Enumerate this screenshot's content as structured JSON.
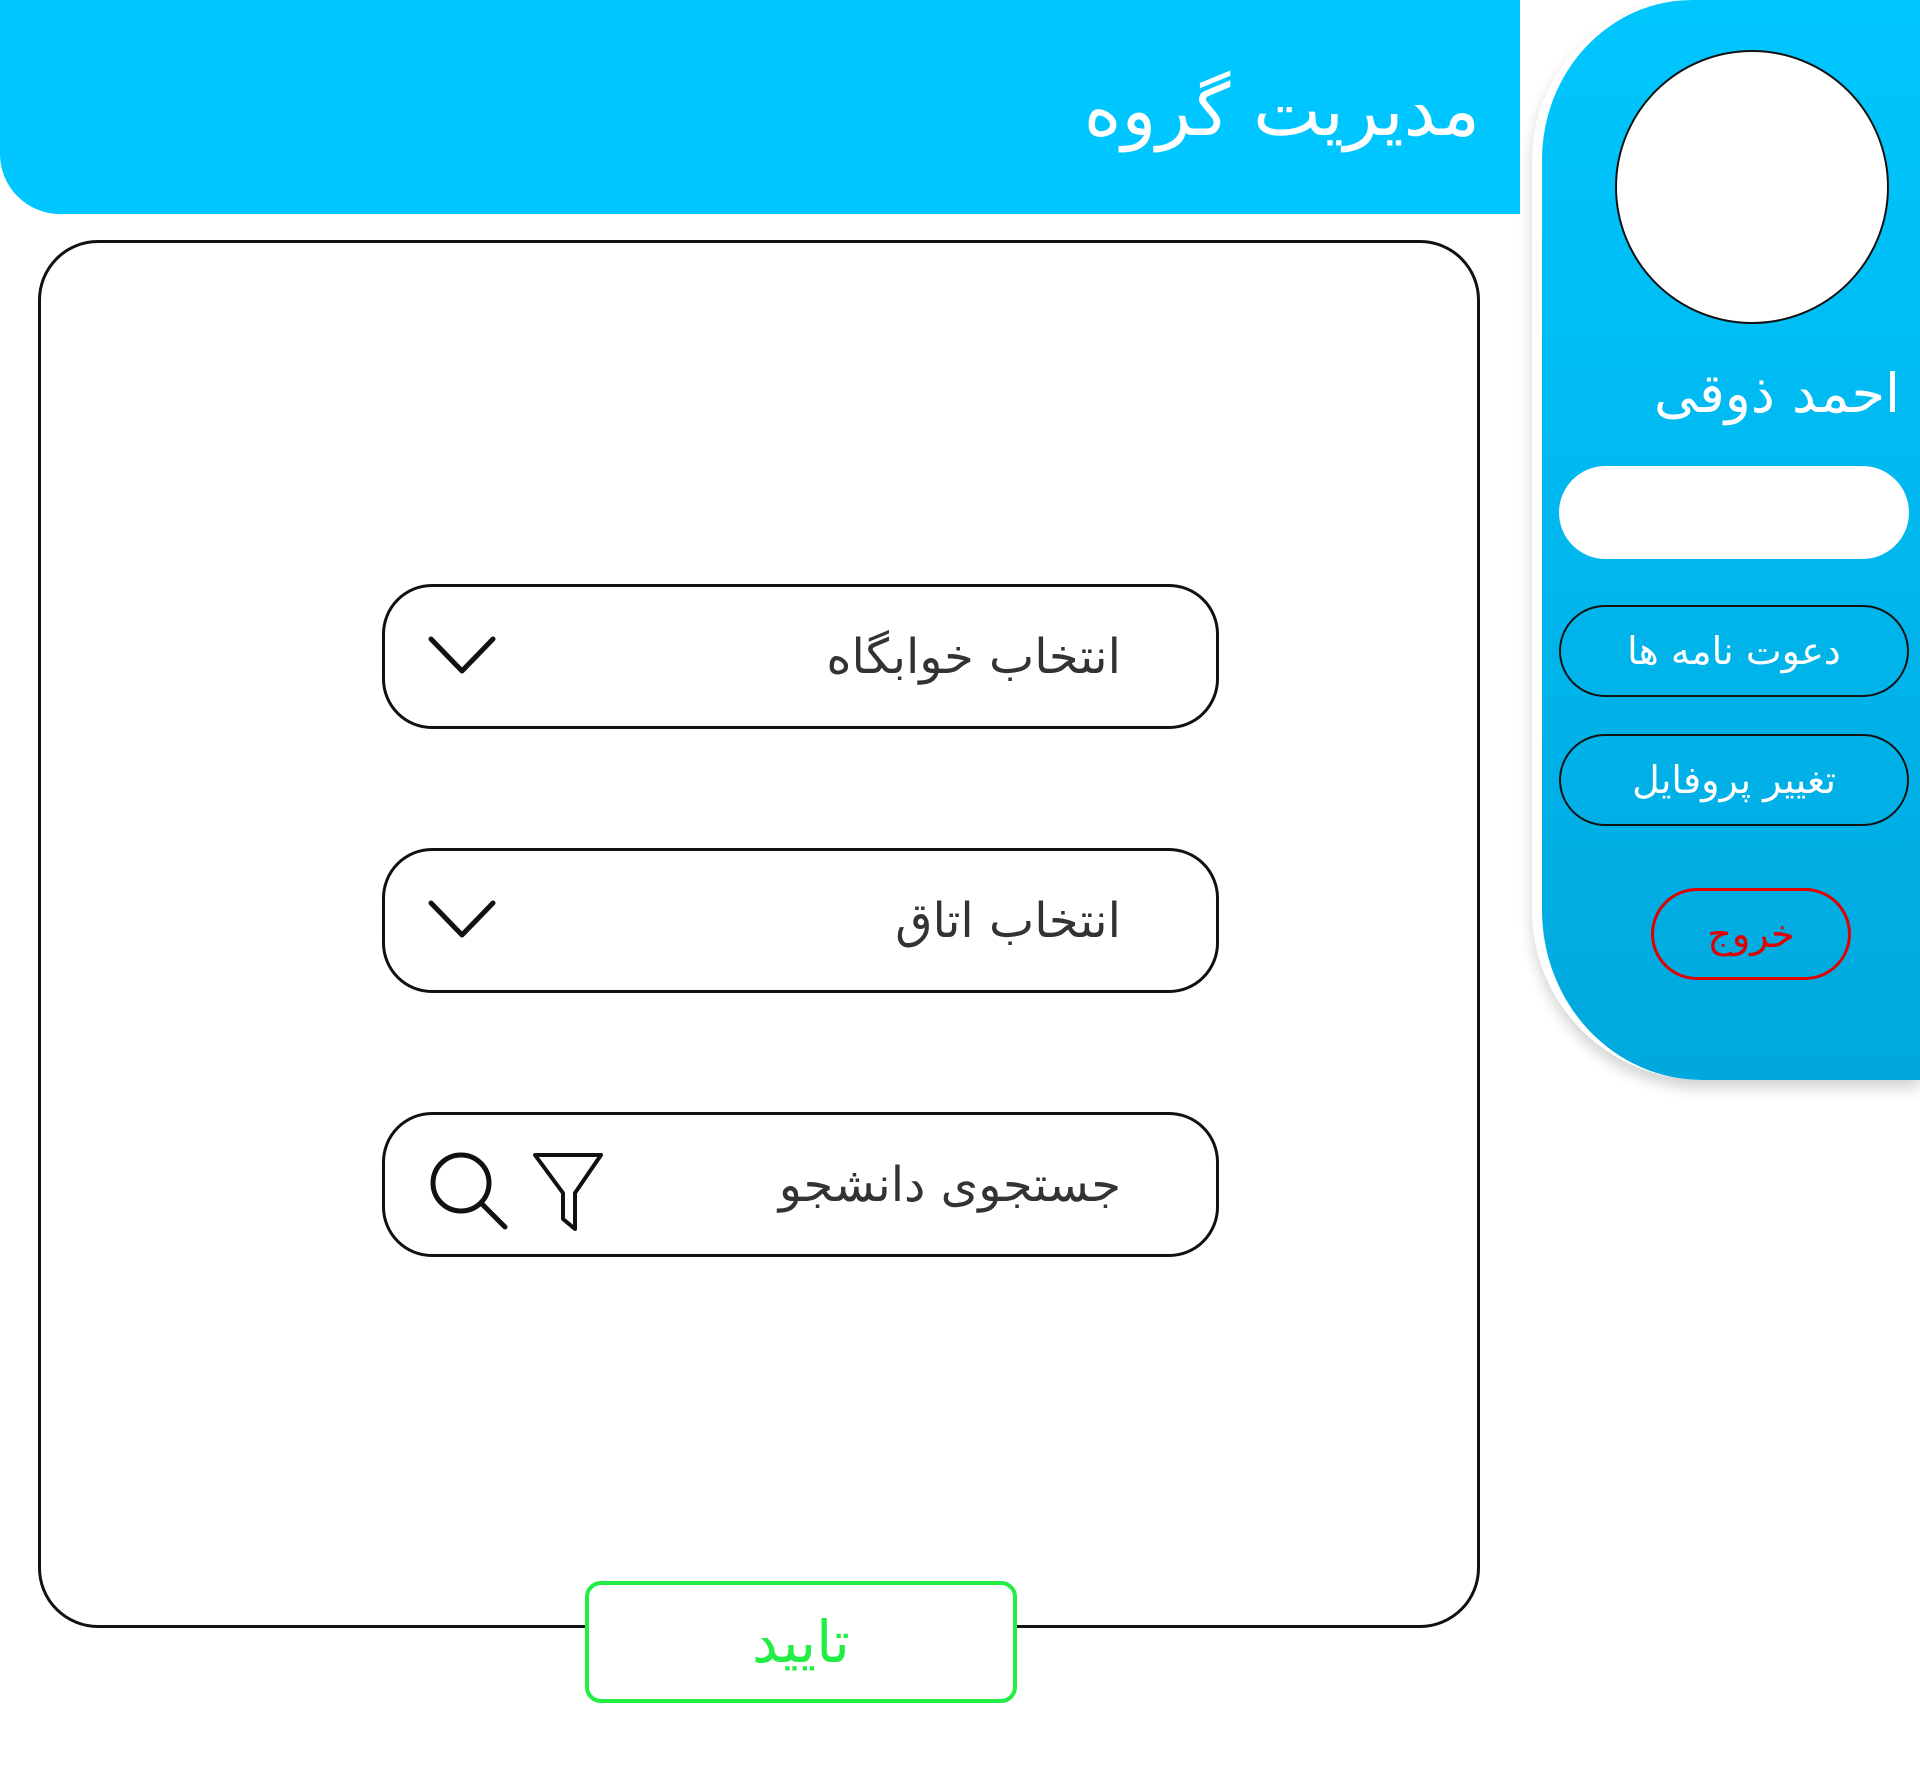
{
  "header": {
    "title": "مدیریت گروه"
  },
  "sidebar": {
    "user_name": "احمد ذوقی",
    "buttons": {
      "invites": "دعوت نامه ها",
      "change_profile": "تغییر پروفایل",
      "logout": "خروج"
    }
  },
  "main": {
    "dorm_select_label": "انتخاب خوابگاه",
    "room_select_label": "انتخاب اتاق",
    "student_search_label": "جستجوی دانشجو",
    "confirm_label": "تایید"
  },
  "icons": {
    "dropdown": "chevron-down-icon",
    "search": "search-icon",
    "filter": "filter-icon"
  },
  "colors": {
    "header_bg": "#00c6ff",
    "sidebar_bg": "#00a8dd",
    "logout": "#e00000",
    "confirm": "#22ee44"
  }
}
